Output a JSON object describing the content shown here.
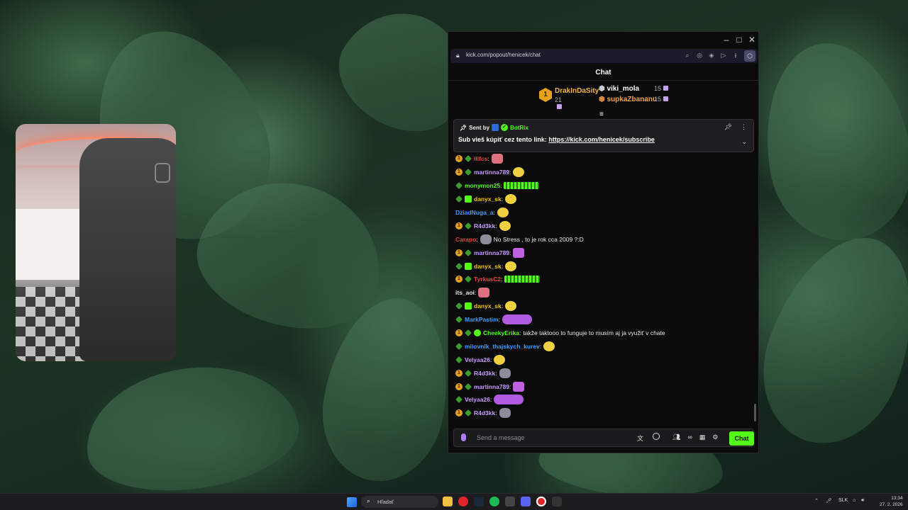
{
  "browser": {
    "url": "kick.com/popout/henicek/chat"
  },
  "chat": {
    "header": "Chat",
    "leaderboard": {
      "first": {
        "rank": "1",
        "name": "DrakInDaSity",
        "count": "21"
      },
      "second": {
        "name": "viki_mola",
        "count": "15"
      },
      "third": {
        "name": "supkaZbananu",
        "count": "15"
      }
    },
    "pinned": {
      "sent_by": "Sent by",
      "bot_name": "BotRix",
      "message_prefix": "Sub vieš kúpiť cez tento link:",
      "link": "https://kick.com/henicek/subscribe"
    },
    "messages": [
      {
        "badges": [
          "gold",
          "og"
        ],
        "user": "lllfcs",
        "color": "#e8443a",
        "emote": "pink"
      },
      {
        "badges": [
          "gold",
          "og"
        ],
        "user": "martinna789",
        "color": "#c79bff",
        "emote": "yellow"
      },
      {
        "badges": [
          "og"
        ],
        "user": "monymon25",
        "color": "#53fc18",
        "emote": "wide"
      },
      {
        "badges": [
          "og",
          "sub"
        ],
        "user": "danyx_sk",
        "color": "#f2c200",
        "emote": "yellow"
      },
      {
        "badges": [],
        "user": "DziadNuga_a",
        "color": "#3aa0ff",
        "emote": "yellow"
      },
      {
        "badges": [
          "gold",
          "og"
        ],
        "user": "R4d3kk",
        "color": "#c79bff",
        "emote": "yellow"
      },
      {
        "badges": [],
        "user": "Carapo",
        "color": "#e8443a",
        "emote": "grey",
        "text": "No Stress , to je rok cca 2009 ?:D"
      },
      {
        "badges": [
          "gold",
          "og"
        ],
        "user": "martinna789",
        "color": "#c79bff",
        "emote": "purple"
      },
      {
        "badges": [
          "og",
          "sub"
        ],
        "user": "danyx_sk",
        "color": "#f2c200",
        "emote": "yellow"
      },
      {
        "badges": [
          "gold",
          "og"
        ],
        "user": "TyrkusC2",
        "color": "#e8443a",
        "emote": "wide"
      },
      {
        "badges": [],
        "user": "its_aoi",
        "color": "#e8e8e8",
        "emote": "pink"
      },
      {
        "badges": [
          "og",
          "sub"
        ],
        "user": "danyx_sk",
        "color": "#f2c200",
        "emote": "yellow"
      },
      {
        "badges": [
          "og"
        ],
        "user": "MarkPastim",
        "color": "#3aa0ff",
        "emote": "multi"
      },
      {
        "badges": [
          "gold",
          "og",
          "ver"
        ],
        "user": "CheekyErika",
        "color": "#53fc18",
        "text": "takže taktooo to funguje to musím aj ja využiť v chate"
      },
      {
        "badges": [
          "og"
        ],
        "user": "milovnik_thajskych_kurev",
        "color": "#3aa0ff",
        "emote": "yellow"
      },
      {
        "badges": [
          "og"
        ],
        "user": "Velyaa26",
        "color": "#c79bff",
        "emote": "yellow"
      },
      {
        "badges": [
          "gold",
          "og"
        ],
        "user": "R4d3kk",
        "color": "#c79bff",
        "emote": "grey"
      },
      {
        "badges": [
          "gold",
          "og"
        ],
        "user": "martinna789",
        "color": "#c79bff",
        "emote": "purple"
      },
      {
        "badges": [
          "og"
        ],
        "user": "Velyaa26",
        "color": "#c79bff",
        "emote": "multi"
      },
      {
        "badges": [
          "gold",
          "og"
        ],
        "user": "R4d3kk",
        "color": "#c79bff",
        "emote": "grey"
      }
    ],
    "input_placeholder": "Send a message",
    "send_label": "Chat"
  },
  "taskbar": {
    "search_text": "Hľadať",
    "lang": "SLK",
    "time": "13:34",
    "date": "27. 2. 2026"
  }
}
